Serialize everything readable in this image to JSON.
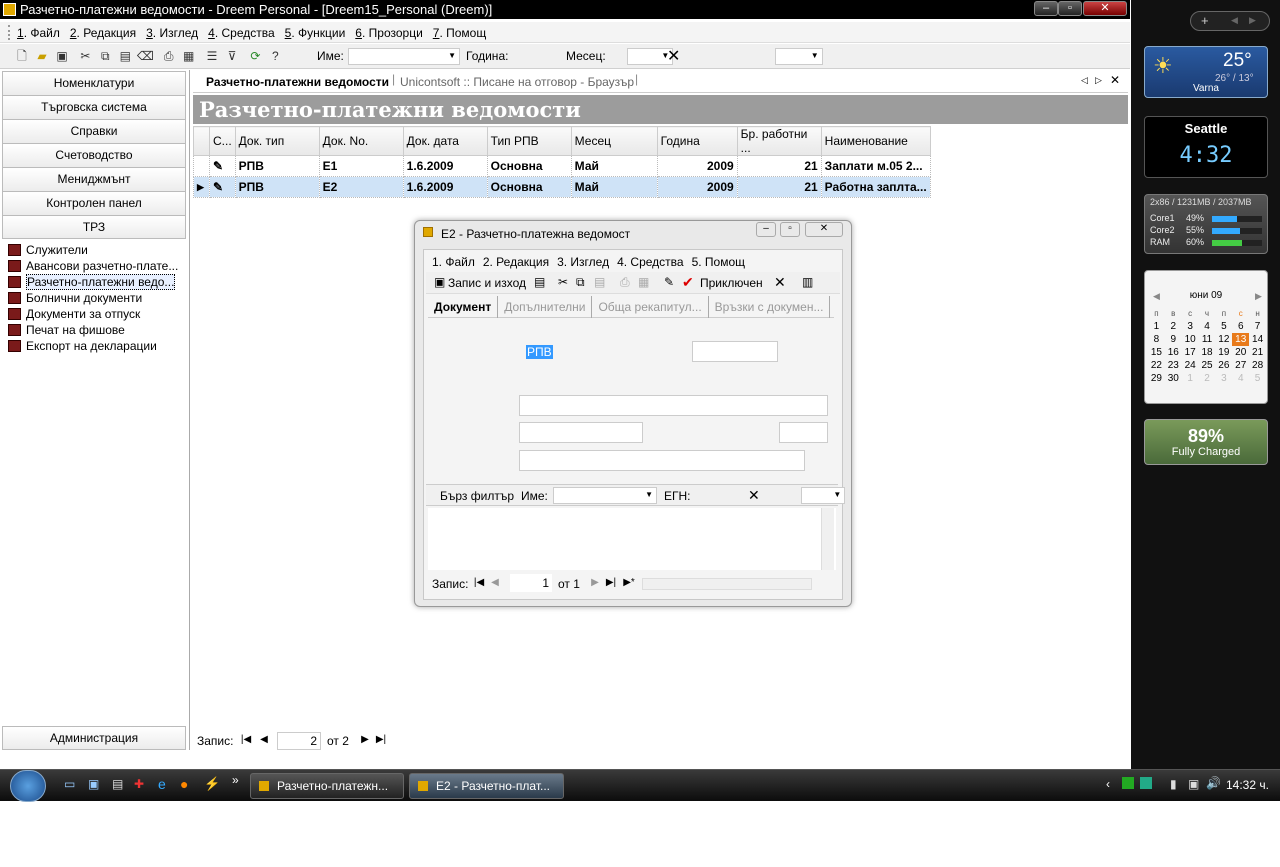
{
  "window": {
    "title": "Разчетно-платежни ведомости - Dreem Personal - [Dreem15_Personal (Dreem)]"
  },
  "menu": [
    {
      "key": "1",
      "label": ". Файл"
    },
    {
      "key": "2",
      "label": ". Редакция"
    },
    {
      "key": "3",
      "label": ". Изглед"
    },
    {
      "key": "4",
      "label": ". Средства"
    },
    {
      "key": "5",
      "label": ". Функции"
    },
    {
      "key": "6",
      "label": ". Прозорци"
    },
    {
      "key": "7",
      "label": ". Помощ"
    }
  ],
  "toolbar": {
    "name_label": "Име:",
    "year_label": "Година:",
    "month_label": "Месец:"
  },
  "nav": {
    "buttons": [
      "Номенклатури",
      "Търговска система",
      "Справки",
      "Счетоводство",
      "Мениджмънт",
      "Контролен панел",
      "ТРЗ"
    ],
    "tree": [
      "Служители",
      "Авансови разчетно-плате...",
      "Разчетно-платежни ведо...",
      "Болнични документи",
      "Документи за отпуск",
      "Печат на фишове",
      "Експорт на декларации"
    ],
    "bottom": "Администрация"
  },
  "tabs": {
    "active": "Разчетно-платежни ведомости",
    "other": "Unicontsoft :: Писане на отговор - Браузър"
  },
  "page": {
    "title": "Разчетно-платежни ведомости"
  },
  "grid": {
    "columns": [
      "С...",
      "Док. тип",
      "Док. No.",
      "Док. дата",
      "Тип РПВ",
      "Месец",
      "Година",
      "Бр. работни ...",
      "Наименование"
    ],
    "rows": [
      [
        "РПВ",
        "E1",
        "1.6.2009",
        "Основна",
        "Май",
        "2009",
        "21",
        "Заплати м.05 2..."
      ],
      [
        "РПВ",
        "E2",
        "1.6.2009",
        "Основна",
        "Май",
        "2009",
        "21",
        "Работна заплта..."
      ]
    ]
  },
  "status": {
    "label": "Запис:",
    "current": "2",
    "of": "от 2"
  },
  "dialog": {
    "title": "E2 - Разчетно-платежна ведомост",
    "menu": [
      "1. Файл",
      "2. Редакция",
      "3. Изглед",
      "4. Средства",
      "5. Помощ"
    ],
    "save_label": "Запис и изход",
    "close_doc_label": "Приключен",
    "tabs": [
      "Документ",
      "Допълнителни",
      "Обща рекапитул...",
      "Връзки с докумен..."
    ],
    "doc_type_value": "РПВ",
    "filter": {
      "label": "Бърз филтър",
      "name_label": "Име:",
      "egn_label": "ЕГН:"
    },
    "status": {
      "label": "Запис:",
      "current": "1",
      "of": "от 1"
    }
  },
  "taskbar": {
    "buttons": [
      "Разчетно-платежн...",
      "E2 - Разчетно-плат..."
    ],
    "clock": "14:32 ч."
  },
  "gadgets": {
    "weather": {
      "temp": "25°",
      "range": "26° / 13°",
      "city": "Varna"
    },
    "clock": {
      "city": "Seattle",
      "time": "4:32"
    },
    "cpu": {
      "header": "2x86 / 1231MB / 2037MB",
      "rows": [
        {
          "label": "Core1",
          "value": "49%"
        },
        {
          "label": "Core2",
          "value": "55%"
        },
        {
          "label": "RAM",
          "value": "60%"
        }
      ]
    },
    "calendar": {
      "month": "юни 09",
      "days": [
        "п",
        "в",
        "с",
        "ч",
        "п",
        "с",
        "н"
      ],
      "weeks": [
        [
          "1",
          "2",
          "3",
          "4",
          "5",
          "6",
          "7"
        ],
        [
          "8",
          "9",
          "10",
          "11",
          "12",
          "13",
          "14"
        ],
        [
          "15",
          "16",
          "17",
          "18",
          "19",
          "20",
          "21"
        ],
        [
          "22",
          "23",
          "24",
          "25",
          "26",
          "27",
          "28"
        ],
        [
          "29",
          "30",
          "1",
          "2",
          "3",
          "4",
          "5"
        ]
      ],
      "today": "13"
    },
    "battery": {
      "percent": "89%",
      "status": "Fully Charged"
    }
  },
  "colors": {
    "selection": "#cfe3f7",
    "header_gray": "#9c9c9c",
    "today": "#e87a1a"
  }
}
